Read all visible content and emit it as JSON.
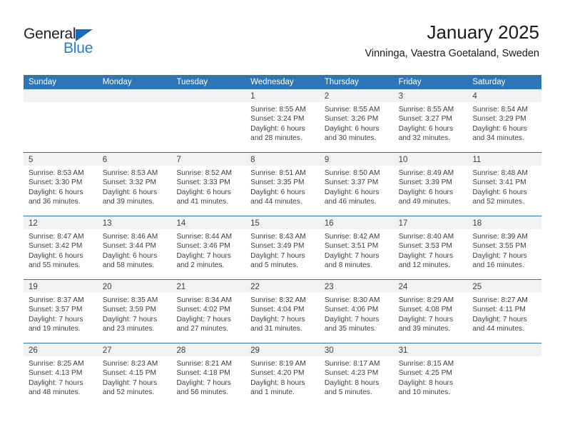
{
  "brand": {
    "name_part1": "General",
    "name_part2": "Blue",
    "triangle_color": "#1c6cb5",
    "blue_color": "#1c7fd4"
  },
  "header": {
    "title": "January 2025",
    "subtitle": "Vinninga, Vaestra Goetaland, Sweden"
  },
  "theme": {
    "header_blue": "#2e75b6",
    "daynum_band": "#f2f2f2",
    "text": "#3f3f3f"
  },
  "weekdays": [
    "Sunday",
    "Monday",
    "Tuesday",
    "Wednesday",
    "Thursday",
    "Friday",
    "Saturday"
  ],
  "weeks": [
    [
      {
        "day": "",
        "lines": []
      },
      {
        "day": "",
        "lines": []
      },
      {
        "day": "",
        "lines": []
      },
      {
        "day": "1",
        "lines": [
          "Sunrise: 8:55 AM",
          "Sunset: 3:24 PM",
          "Daylight: 6 hours",
          "and 28 minutes."
        ]
      },
      {
        "day": "2",
        "lines": [
          "Sunrise: 8:55 AM",
          "Sunset: 3:26 PM",
          "Daylight: 6 hours",
          "and 30 minutes."
        ]
      },
      {
        "day": "3",
        "lines": [
          "Sunrise: 8:55 AM",
          "Sunset: 3:27 PM",
          "Daylight: 6 hours",
          "and 32 minutes."
        ]
      },
      {
        "day": "4",
        "lines": [
          "Sunrise: 8:54 AM",
          "Sunset: 3:29 PM",
          "Daylight: 6 hours",
          "and 34 minutes."
        ]
      }
    ],
    [
      {
        "day": "5",
        "lines": [
          "Sunrise: 8:53 AM",
          "Sunset: 3:30 PM",
          "Daylight: 6 hours",
          "and 36 minutes."
        ]
      },
      {
        "day": "6",
        "lines": [
          "Sunrise: 8:53 AM",
          "Sunset: 3:32 PM",
          "Daylight: 6 hours",
          "and 39 minutes."
        ]
      },
      {
        "day": "7",
        "lines": [
          "Sunrise: 8:52 AM",
          "Sunset: 3:33 PM",
          "Daylight: 6 hours",
          "and 41 minutes."
        ]
      },
      {
        "day": "8",
        "lines": [
          "Sunrise: 8:51 AM",
          "Sunset: 3:35 PM",
          "Daylight: 6 hours",
          "and 44 minutes."
        ]
      },
      {
        "day": "9",
        "lines": [
          "Sunrise: 8:50 AM",
          "Sunset: 3:37 PM",
          "Daylight: 6 hours",
          "and 46 minutes."
        ]
      },
      {
        "day": "10",
        "lines": [
          "Sunrise: 8:49 AM",
          "Sunset: 3:39 PM",
          "Daylight: 6 hours",
          "and 49 minutes."
        ]
      },
      {
        "day": "11",
        "lines": [
          "Sunrise: 8:48 AM",
          "Sunset: 3:41 PM",
          "Daylight: 6 hours",
          "and 52 minutes."
        ]
      }
    ],
    [
      {
        "day": "12",
        "lines": [
          "Sunrise: 8:47 AM",
          "Sunset: 3:42 PM",
          "Daylight: 6 hours",
          "and 55 minutes."
        ]
      },
      {
        "day": "13",
        "lines": [
          "Sunrise: 8:46 AM",
          "Sunset: 3:44 PM",
          "Daylight: 6 hours",
          "and 58 minutes."
        ]
      },
      {
        "day": "14",
        "lines": [
          "Sunrise: 8:44 AM",
          "Sunset: 3:46 PM",
          "Daylight: 7 hours",
          "and 2 minutes."
        ]
      },
      {
        "day": "15",
        "lines": [
          "Sunrise: 8:43 AM",
          "Sunset: 3:49 PM",
          "Daylight: 7 hours",
          "and 5 minutes."
        ]
      },
      {
        "day": "16",
        "lines": [
          "Sunrise: 8:42 AM",
          "Sunset: 3:51 PM",
          "Daylight: 7 hours",
          "and 8 minutes."
        ]
      },
      {
        "day": "17",
        "lines": [
          "Sunrise: 8:40 AM",
          "Sunset: 3:53 PM",
          "Daylight: 7 hours",
          "and 12 minutes."
        ]
      },
      {
        "day": "18",
        "lines": [
          "Sunrise: 8:39 AM",
          "Sunset: 3:55 PM",
          "Daylight: 7 hours",
          "and 16 minutes."
        ]
      }
    ],
    [
      {
        "day": "19",
        "lines": [
          "Sunrise: 8:37 AM",
          "Sunset: 3:57 PM",
          "Daylight: 7 hours",
          "and 19 minutes."
        ]
      },
      {
        "day": "20",
        "lines": [
          "Sunrise: 8:35 AM",
          "Sunset: 3:59 PM",
          "Daylight: 7 hours",
          "and 23 minutes."
        ]
      },
      {
        "day": "21",
        "lines": [
          "Sunrise: 8:34 AM",
          "Sunset: 4:02 PM",
          "Daylight: 7 hours",
          "and 27 minutes."
        ]
      },
      {
        "day": "22",
        "lines": [
          "Sunrise: 8:32 AM",
          "Sunset: 4:04 PM",
          "Daylight: 7 hours",
          "and 31 minutes."
        ]
      },
      {
        "day": "23",
        "lines": [
          "Sunrise: 8:30 AM",
          "Sunset: 4:06 PM",
          "Daylight: 7 hours",
          "and 35 minutes."
        ]
      },
      {
        "day": "24",
        "lines": [
          "Sunrise: 8:29 AM",
          "Sunset: 4:08 PM",
          "Daylight: 7 hours",
          "and 39 minutes."
        ]
      },
      {
        "day": "25",
        "lines": [
          "Sunrise: 8:27 AM",
          "Sunset: 4:11 PM",
          "Daylight: 7 hours",
          "and 44 minutes."
        ]
      }
    ],
    [
      {
        "day": "26",
        "lines": [
          "Sunrise: 8:25 AM",
          "Sunset: 4:13 PM",
          "Daylight: 7 hours",
          "and 48 minutes."
        ]
      },
      {
        "day": "27",
        "lines": [
          "Sunrise: 8:23 AM",
          "Sunset: 4:15 PM",
          "Daylight: 7 hours",
          "and 52 minutes."
        ]
      },
      {
        "day": "28",
        "lines": [
          "Sunrise: 8:21 AM",
          "Sunset: 4:18 PM",
          "Daylight: 7 hours",
          "and 56 minutes."
        ]
      },
      {
        "day": "29",
        "lines": [
          "Sunrise: 8:19 AM",
          "Sunset: 4:20 PM",
          "Daylight: 8 hours",
          "and 1 minute."
        ]
      },
      {
        "day": "30",
        "lines": [
          "Sunrise: 8:17 AM",
          "Sunset: 4:23 PM",
          "Daylight: 8 hours",
          "and 5 minutes."
        ]
      },
      {
        "day": "31",
        "lines": [
          "Sunrise: 8:15 AM",
          "Sunset: 4:25 PM",
          "Daylight: 8 hours",
          "and 10 minutes."
        ]
      },
      {
        "day": "",
        "lines": []
      }
    ]
  ]
}
